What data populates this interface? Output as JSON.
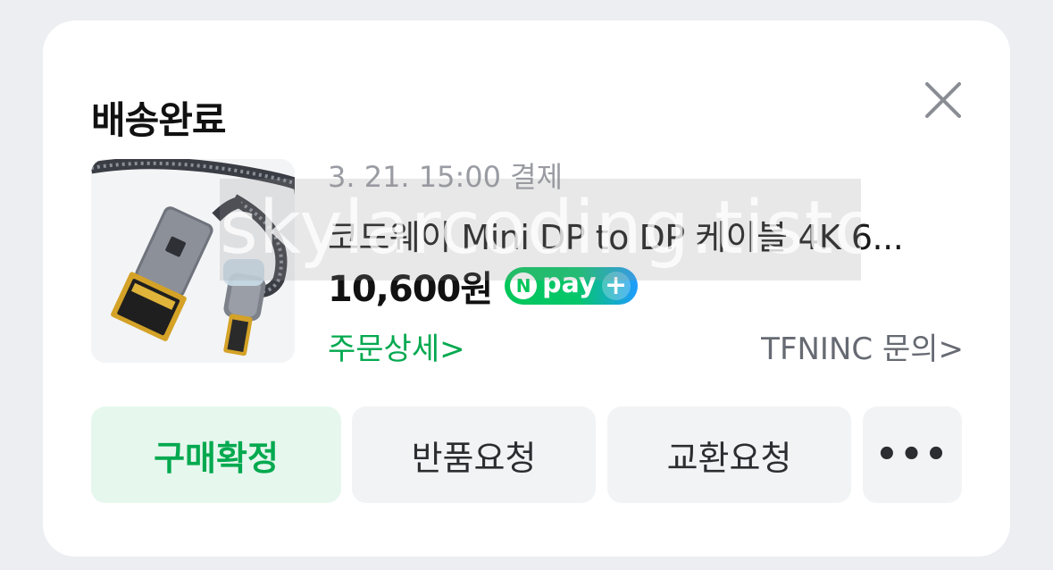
{
  "card": {
    "title": "배송완료",
    "payment_date": "3. 21. 15:00 결제",
    "product_name": "코드웨이 Mini DP to DP 케이블 4K 6...",
    "price": "10,600원",
    "npay": {
      "n": "N",
      "text": "pay",
      "plus": "+"
    },
    "order_detail_link": "주문상세>",
    "seller_inquiry_link": "TFNINC 문의>",
    "watermark": "skylarcoding.tistory",
    "buttons": {
      "confirm": "구매확정",
      "return": "반품요청",
      "exchange": "교환요청",
      "more": "•••"
    },
    "icons": {
      "close": "close-icon",
      "product": "product-thumbnail"
    },
    "colors": {
      "accent_green": "#03a94f",
      "confirm_bg": "#e6f7ee",
      "button_bg": "#f2f3f5",
      "page_bg": "#eceef2"
    }
  }
}
